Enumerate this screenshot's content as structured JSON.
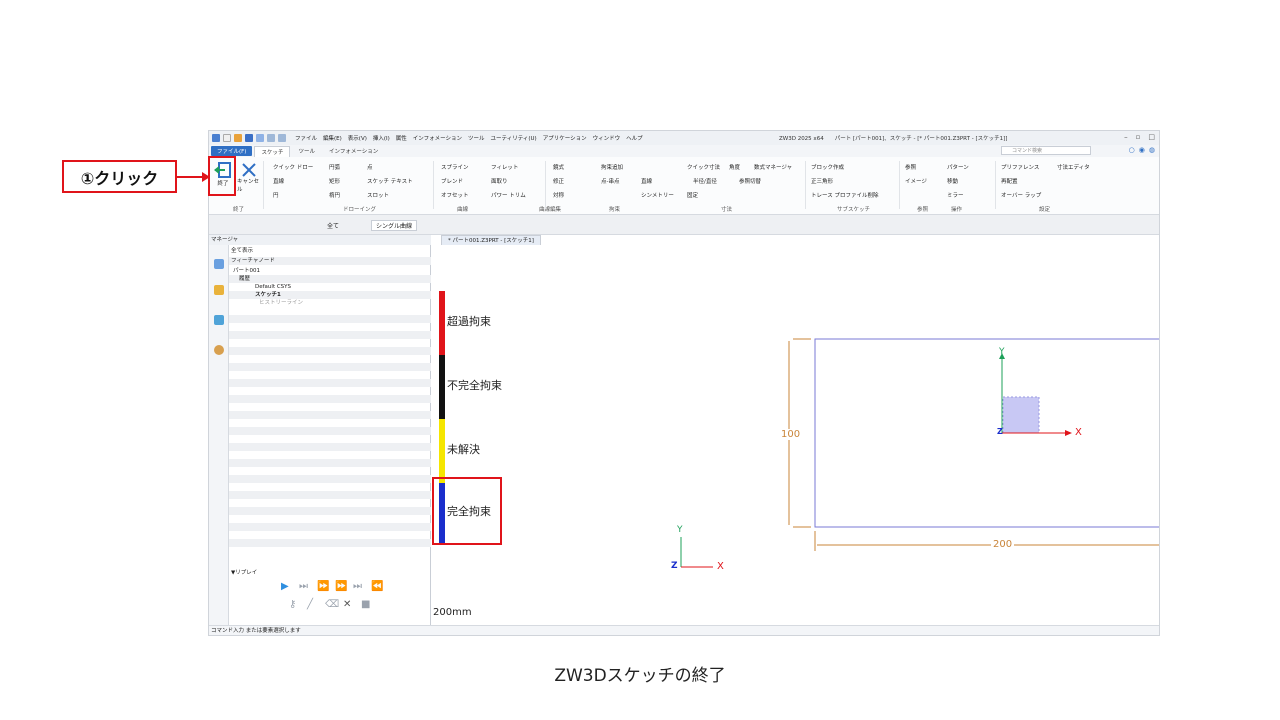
{
  "annotation": {
    "callout_label": "①クリック",
    "caption": "ZW3Dスケッチの終了"
  },
  "app": {
    "menu_items": [
      "ファイル",
      "編集(E)",
      "表示(V)",
      "挿入(I)",
      "属性",
      "インフォメーション",
      "ツール",
      "ユーティリティ(U)",
      "アプリケーション",
      "ウィンドウ",
      "ヘルプ"
    ],
    "window_title": "ZW3D 2025 x64　　パート [パート001]、スケッチ - [* パート001.Z3PRT - [スケッチ1]]",
    "tabs": [
      "ファイル(F)",
      "スケッチ",
      "ツール",
      "インフォメーション"
    ],
    "search_placeholder": "コマンド検索"
  },
  "ribbon": {
    "finish": "終了",
    "cancel": "キャンセル",
    "groups": [
      "終了",
      "ドローイング",
      "曲線",
      "曲線編集",
      "拘束",
      "寸法",
      "サブスケッチ",
      "参照",
      "操作",
      "設定"
    ],
    "drawing": [
      "クイック ドロー",
      "円弧",
      "点",
      "直線",
      "矩形",
      "スケッチ テキスト",
      "円",
      "楕円",
      "スロット"
    ],
    "curves": [
      "スプライン",
      "ブレンド",
      "オフセット",
      "フィレット",
      "面取り",
      "パワー トリム"
    ],
    "edit": [
      "鏡式",
      "修正",
      "対称",
      "拘束追加",
      "点-串点",
      "直線",
      "シンメトリー",
      "固定"
    ],
    "dims": [
      "クイック寸法",
      "角度",
      "半径/直径",
      "参照切替",
      "数式マネージャ"
    ],
    "sub": [
      "ブロック作成",
      "正三角形",
      "トレース プロファイル削除"
    ],
    "ref": [
      "参照",
      "イメージ"
    ],
    "ops": [
      "パターン",
      "移動",
      "ミラー"
    ],
    "settings": [
      "プリファレンス",
      "再配置",
      "オーバー ラップ",
      "寸法エディタ"
    ]
  },
  "toolrow": {
    "all_label": "全て",
    "filter_label": "シングル曲線"
  },
  "manager": {
    "title": "マネージャ",
    "display": "全て表示",
    "column": "フィーチャノード",
    "tree": [
      "パート001",
      "履歴",
      "Default CSYS",
      "スケッチ1",
      "ヒストリーライン"
    ],
    "replay": "▼リプレイ"
  },
  "viewport": {
    "doc_tab": "* パート001.Z3PRT - [スケッチ1]",
    "dim_height": "100",
    "dim_width": "200",
    "axis_x": "X",
    "axis_y": "Y",
    "axis_z": "Z",
    "scale_label": "200mm"
  },
  "legend": {
    "items": [
      {
        "label": "超過拘束",
        "color": "#e0141a"
      },
      {
        "label": "不完全拘束",
        "color": "#111111"
      },
      {
        "label": "未解決",
        "color": "#f5e600"
      },
      {
        "label": "完全拘束",
        "color": "#1a2ecc"
      }
    ]
  },
  "statusbar": {
    "text": "コマンド入力 または要素選択します"
  }
}
